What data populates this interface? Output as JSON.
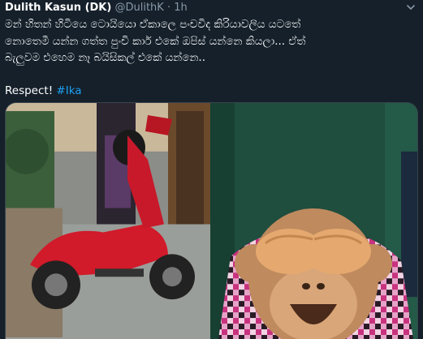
{
  "tweet": {
    "author_name": "Dulith Kasun (DK)",
    "author_handle": "@DulithK",
    "separator": "·",
    "time": "1h",
    "text_lines": [
      "මන් හිතන් හිටියෙ ටොයියො ඒකාලෙ පංචවිද කිරියාවලිය යටතේ",
      "නොතෙමී යන්න ගත්ත පුංචි කාර් එකේ ඔපිස් යන්නෙ කියලා... ඒත්",
      "බැලුවම එහෙම නෑ බයිසිකල් එකේ යන්නෙ.."
    ],
    "respect_text": "Respect!",
    "hashtag": "#Ika"
  },
  "icons": {
    "menu": "chevron-down-icon",
    "emoji": "see-no-evil-monkey-icon"
  },
  "colors": {
    "background": "#15202b",
    "secondary_text": "#8899a6",
    "link": "#1da1f2",
    "scooter_red": "#d11a2a",
    "curtain_green": "#1f4d3e",
    "dress_pink": "#c8327e"
  }
}
